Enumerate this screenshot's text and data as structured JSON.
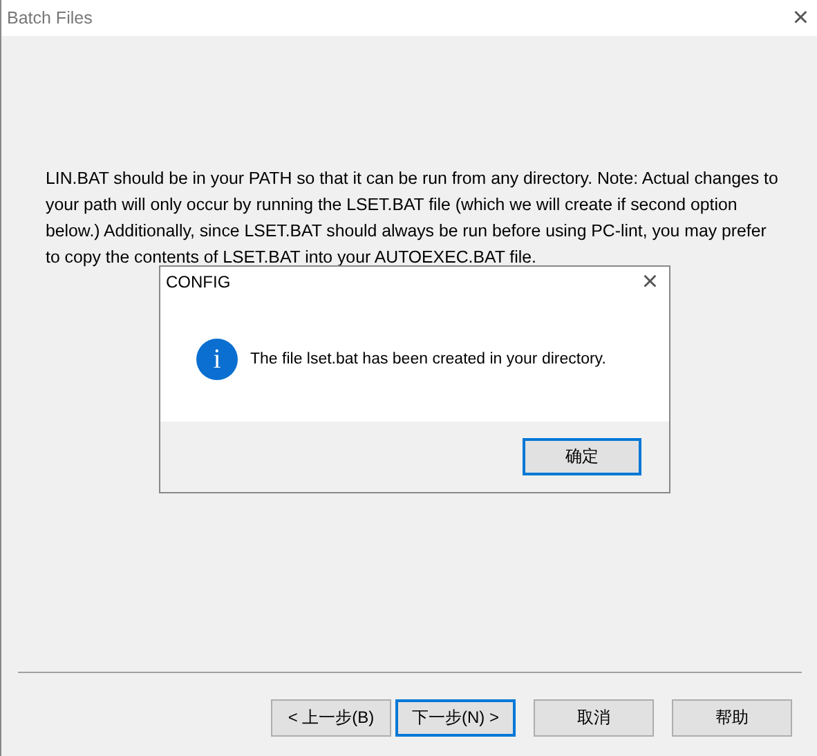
{
  "window": {
    "title": "Batch Files",
    "close": "×"
  },
  "description": "LIN.BAT should be in your PATH so that it can be run from any directory.  Note: Actual changes to your path will only occur by running the LSET.BAT file (which we will create if second option below.)  Additionally, since LSET.BAT should always be run before using PC-lint, you may prefer to copy the contents of LSET.BAT into your AUTOEXEC.BAT file.",
  "buttons": [
    {
      "label": "< 上一步(B)",
      "focused": false
    },
    {
      "label": "下一步(N) >",
      "focused": true
    },
    {
      "label": "取消",
      "focused": false
    },
    {
      "label": "帮助",
      "focused": false
    }
  ],
  "dialog": {
    "title": "CONFIG",
    "close": "×",
    "icon": "i",
    "message": "The file lset.bat has been created in your directory.",
    "buttons": [
      {
        "label": "确定",
        "focused": true
      }
    ]
  }
}
